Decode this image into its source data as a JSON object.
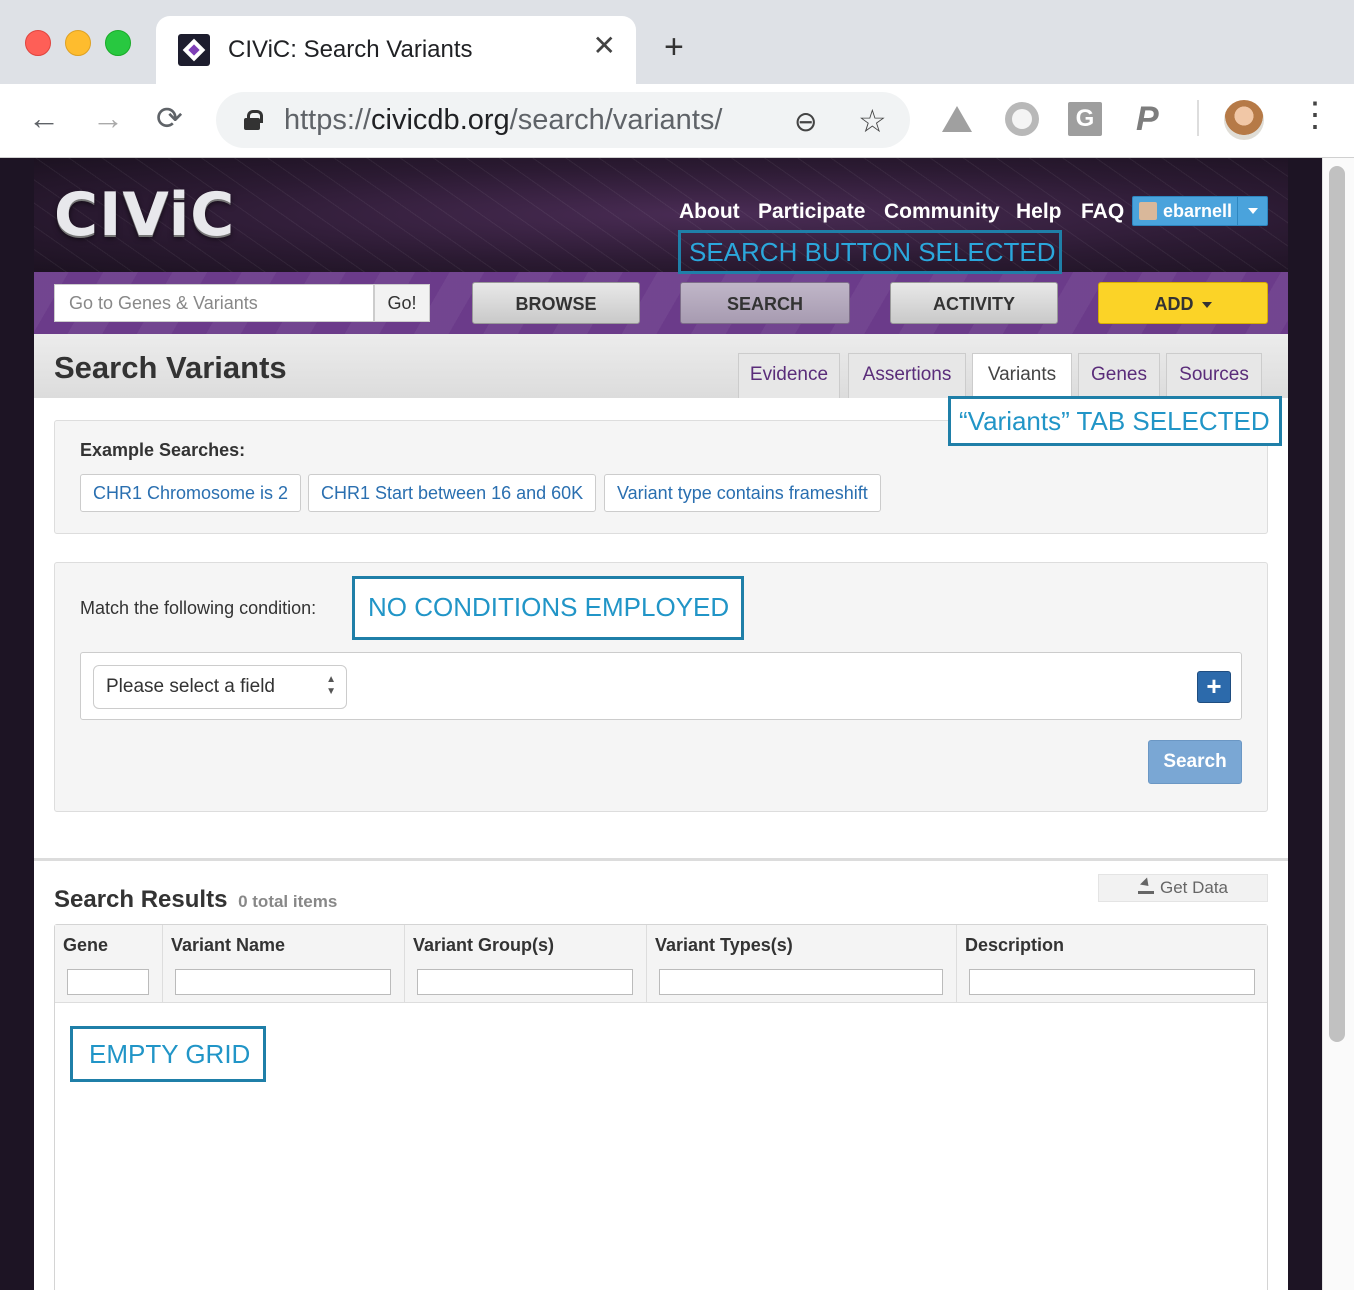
{
  "browser": {
    "tab_title": "CIViC: Search Variants",
    "close_glyph": "✕",
    "new_tab_glyph": "+",
    "url_scheme": "https://",
    "url_host": "civicdb.org",
    "url_path": "/search/variants/",
    "ext_g": "G",
    "ext_p": "P"
  },
  "site": {
    "logo": "CIViC",
    "nav": [
      "About",
      "Participate",
      "Community",
      "Help",
      "FAQ"
    ],
    "user": "ebarnell",
    "goto_placeholder": "Go to Genes & Variants",
    "go_label": "Go!",
    "buttons": {
      "browse": "BROWSE",
      "search": "SEARCH",
      "activity": "ACTIVITY",
      "add": "ADD"
    }
  },
  "page": {
    "title": "Search Variants",
    "tabs": [
      "Evidence",
      "Assertions",
      "Variants",
      "Genes",
      "Sources"
    ],
    "selected_tab": "Variants"
  },
  "examples": {
    "label": "Example Searches:",
    "chips": [
      "CHR1 Chromosome is 2",
      "CHR1 Start between 16 and 60K",
      "Variant type contains frameshift"
    ]
  },
  "conditions": {
    "label": "Match the following condition:",
    "field_select": "Please select a field",
    "add_glyph": "+",
    "search_button": "Search"
  },
  "results": {
    "title": "Search Results",
    "count": "0 total items",
    "get_data": "Get Data",
    "columns": [
      "Gene",
      "Variant Name",
      "Variant Group(s)",
      "Variant Types(s)",
      "Description"
    ]
  },
  "annotations": {
    "search_selected": "SEARCH BUTTON SELECTED",
    "variants_tab": "“Variants” TAB  SELECTED",
    "no_conditions": "NO CONDITIONS EMPLOYED",
    "empty_grid": "EMPTY GRID"
  },
  "colors": {
    "nav_purple": "#6b3b8a",
    "add_yellow": "#fbd327",
    "link_blue": "#2a6fb0",
    "annotation_blue": "#2195c7"
  }
}
